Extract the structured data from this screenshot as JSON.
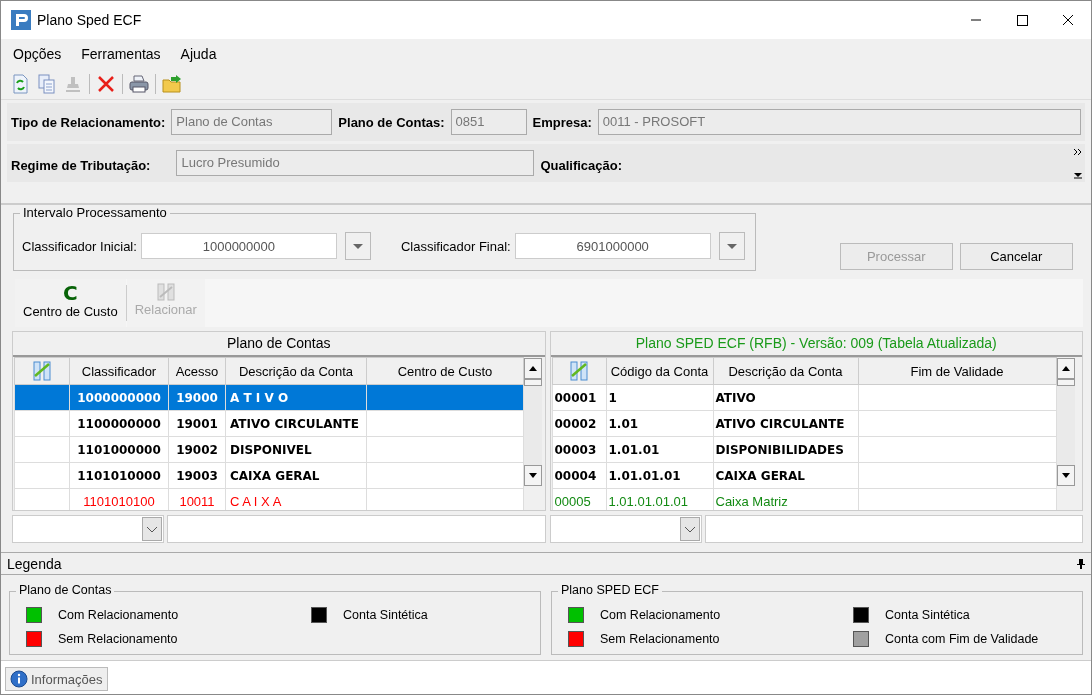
{
  "window": {
    "title": "Plano Sped ECF"
  },
  "menu": [
    {
      "label": "Opções"
    },
    {
      "label": "Ferramentas"
    },
    {
      "label": "Ajuda"
    }
  ],
  "toolbar": [
    {
      "kind": "refresh",
      "disabled": false
    },
    {
      "kind": "copy",
      "disabled": false
    },
    {
      "kind": "stamp",
      "disabled": true
    },
    {
      "kind": "sep"
    },
    {
      "kind": "delete",
      "disabled": false
    },
    {
      "kind": "sep"
    },
    {
      "kind": "print",
      "disabled": false
    },
    {
      "kind": "sep"
    },
    {
      "kind": "folder",
      "disabled": false
    }
  ],
  "form_rows": [
    {
      "fields": [
        {
          "label": "Tipo de Relacionamento:",
          "value": "Plano de Contas",
          "disabled": true
        },
        {
          "label": "Plano de Contas:",
          "value": "0851",
          "disabled": true
        },
        {
          "label": "Empresa:",
          "value": "0011 - PROSOFT",
          "disabled": true
        }
      ]
    },
    {
      "fields": [
        {
          "label": "Regime de Tributação:",
          "value": "Lucro Presumido",
          "disabled": true
        },
        {
          "label": "Qualificação:"
        }
      ]
    }
  ],
  "interval": {
    "title": "Intervalo Processamento",
    "fields": [
      {
        "label": "Classificador Inicial:",
        "value": "1000000000"
      },
      {
        "label": "Classificador Final:",
        "value": "6901000000"
      }
    ]
  },
  "buttons": [
    {
      "label": "Processar",
      "disabled": true
    },
    {
      "label": "Cancelar",
      "disabled": false
    }
  ],
  "ribbon": [
    {
      "kind": "letter",
      "glyph": "C",
      "label": "Centro de Custo",
      "disabled": false
    },
    {
      "kind": "link",
      "label": "Relacionar",
      "disabled": true
    }
  ],
  "grids": [
    {
      "title": "Plano de Contas",
      "columns": [
        {
          "kind": "icon"
        },
        {
          "kind": "text",
          "label": "Classificador"
        },
        {
          "kind": "text",
          "label": "Acesso"
        },
        {
          "kind": "text",
          "label": "Descrição da Conta"
        },
        {
          "kind": "text",
          "label": "Centro de Custo"
        }
      ],
      "rows": [
        {
          "kind": "sintetica",
          "selected": true,
          "cells": [
            "",
            "1000000000",
            "19000",
            "A T I V O",
            ""
          ]
        },
        {
          "kind": "sintetica",
          "selected": false,
          "cells": [
            "",
            "1100000000",
            "19001",
            "ATIVO CIRCULANTE",
            ""
          ]
        },
        {
          "kind": "sintetica",
          "selected": false,
          "cells": [
            "",
            "1101000000",
            "19002",
            "DISPONIVEL",
            ""
          ]
        },
        {
          "kind": "sintetica",
          "selected": false,
          "cells": [
            "",
            "1101010000",
            "19003",
            "CAIXA GERAL",
            ""
          ]
        },
        {
          "kind": "sem",
          "selected": false,
          "cells": [
            "",
            "1101010100",
            "10011",
            "C A I X A",
            ""
          ]
        }
      ]
    },
    {
      "title": "Plano SPED ECF (RFB) - Versão: 009 (Tabela Atualizada)",
      "columns": [
        {
          "kind": "icon"
        },
        {
          "kind": "text",
          "label": "Código da Conta"
        },
        {
          "kind": "text",
          "label": "Descrição da Conta"
        },
        {
          "kind": "text",
          "label": "Fim de Validade"
        }
      ],
      "rows": [
        {
          "kind": "sintetica",
          "selected": false,
          "cells": [
            "00001",
            "1",
            "ATIVO",
            ""
          ]
        },
        {
          "kind": "sintetica",
          "selected": false,
          "cells": [
            "00002",
            "1.01",
            "ATIVO CIRCULANTE",
            ""
          ]
        },
        {
          "kind": "sintetica",
          "selected": false,
          "cells": [
            "00003",
            "1.01.01",
            "DISPONIBILIDADES",
            ""
          ]
        },
        {
          "kind": "sintetica",
          "selected": false,
          "cells": [
            "00004",
            "1.01.01.01",
            "CAIXA GERAL",
            ""
          ]
        },
        {
          "kind": "com",
          "selected": false,
          "cells": [
            "00005",
            "1.01.01.01.01",
            "Caixa Matriz",
            ""
          ]
        }
      ]
    }
  ],
  "legend": {
    "title": "Legenda",
    "groups": [
      {
        "title": "Plano de Contas",
        "items": [
          {
            "label": "Com Relacionamento",
            "color": "#00c000"
          },
          {
            "label": "Sem Relacionamento",
            "color": "#ff0000"
          },
          {
            "label": "Conta Sintética",
            "color": "#000000"
          }
        ]
      },
      {
        "title": "Plano SPED ECF",
        "items": [
          {
            "label": "Com Relacionamento",
            "color": "#00c000"
          },
          {
            "label": "Sem Relacionamento",
            "color": "#ff0000"
          },
          {
            "label": "Conta Sintética",
            "color": "#000000"
          },
          {
            "label": "Conta com Fim de Validade",
            "color": "#a0a0a0"
          }
        ]
      }
    ]
  },
  "bottom_tabs": [
    {
      "label": "Informações",
      "selected": true
    }
  ]
}
